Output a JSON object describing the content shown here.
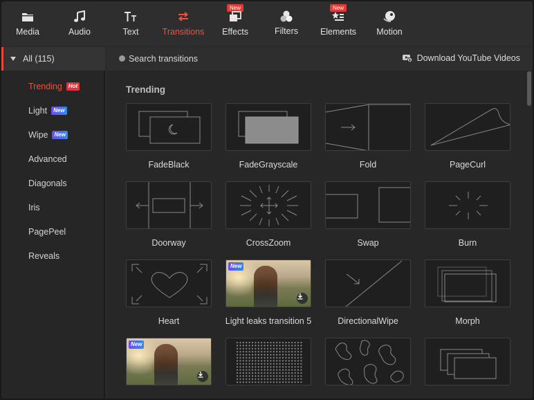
{
  "toolbar": {
    "items": [
      {
        "label": "Media",
        "icon": "folder-icon"
      },
      {
        "label": "Audio",
        "icon": "music-note-icon"
      },
      {
        "label": "Text",
        "icon": "text-icon"
      },
      {
        "label": "Transitions",
        "icon": "transitions-arrows-icon",
        "active": true
      },
      {
        "label": "Effects",
        "icon": "effects-icon",
        "badge": "New"
      },
      {
        "label": "Filters",
        "icon": "filters-icon"
      },
      {
        "label": "Elements",
        "icon": "elements-icon",
        "badge": "New"
      },
      {
        "label": "Motion",
        "icon": "motion-icon"
      }
    ]
  },
  "sidebar": {
    "all_label": "All (115)",
    "items": [
      {
        "label": "Trending",
        "badge": "Hot",
        "active": true
      },
      {
        "label": "Light",
        "badge": "New"
      },
      {
        "label": "Wipe",
        "badge": "New"
      },
      {
        "label": "Advanced"
      },
      {
        "label": "Diagonals"
      },
      {
        "label": "Iris"
      },
      {
        "label": "PagePeel"
      },
      {
        "label": "Reveals"
      }
    ]
  },
  "search": {
    "placeholder": "Search transitions",
    "download_label": "Download YouTube Videos"
  },
  "section_title": "Trending",
  "transitions": [
    {
      "label": "FadeBlack",
      "icon": "fadeblack-icon"
    },
    {
      "label": "FadeGrayscale",
      "icon": "fadegrayscale-icon"
    },
    {
      "label": "Fold",
      "icon": "fold-icon"
    },
    {
      "label": "PageCurl",
      "icon": "pagecurl-icon"
    },
    {
      "label": "Doorway",
      "icon": "doorway-icon"
    },
    {
      "label": "CrossZoom",
      "icon": "crosszoom-icon"
    },
    {
      "label": "Swap",
      "icon": "swap-icon"
    },
    {
      "label": "Burn",
      "icon": "burn-icon"
    },
    {
      "label": "Heart",
      "icon": "heart-icon"
    },
    {
      "label": "Light leaks transition 5",
      "icon": "photo-thumbnail",
      "badge": "New",
      "download": true
    },
    {
      "label": "DirectionalWipe",
      "icon": "directionalwipe-icon"
    },
    {
      "label": "Morph",
      "icon": "morph-icon"
    },
    {
      "label": "",
      "icon": "photo-thumbnail",
      "badge": "New",
      "download": true
    },
    {
      "label": "",
      "icon": "dots-grid-icon"
    },
    {
      "label": "",
      "icon": "blobs-icon"
    },
    {
      "label": "",
      "icon": "layers-icon"
    }
  ],
  "colors": {
    "accent": "#f0503c",
    "hot_badge": "#e0363b",
    "new_badge_from": "#6a4cf0",
    "new_badge_to": "#2d8cf0"
  }
}
